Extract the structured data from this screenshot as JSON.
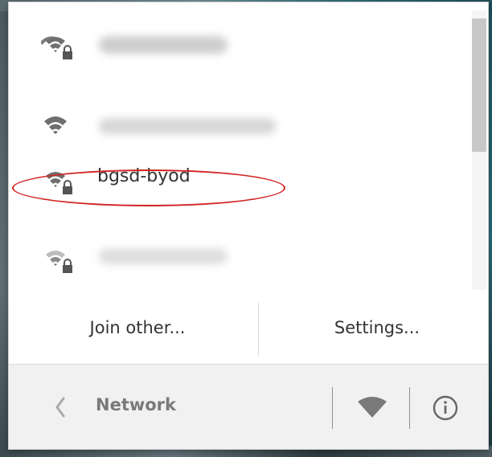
{
  "networks": [
    {
      "name": "",
      "secured": true,
      "blurred": true
    },
    {
      "name": "",
      "secured": false,
      "blurred": true
    },
    {
      "name": "bgsd-byod",
      "secured": true,
      "blurred": false,
      "highlighted": true
    },
    {
      "name": "",
      "secured": true,
      "blurred": true
    }
  ],
  "actions": {
    "join_other_label": "Join other...",
    "settings_label": "Settings..."
  },
  "footer": {
    "title": "Network"
  },
  "colors": {
    "highlight_ring": "#d22222",
    "footer_bg": "#f1f1f1",
    "text": "#333333",
    "muted": "#7a7a7a"
  },
  "icons": {
    "wifi": "wifi-icon",
    "lock": "lock-icon",
    "back": "chevron-left-icon",
    "info": "info-icon"
  }
}
